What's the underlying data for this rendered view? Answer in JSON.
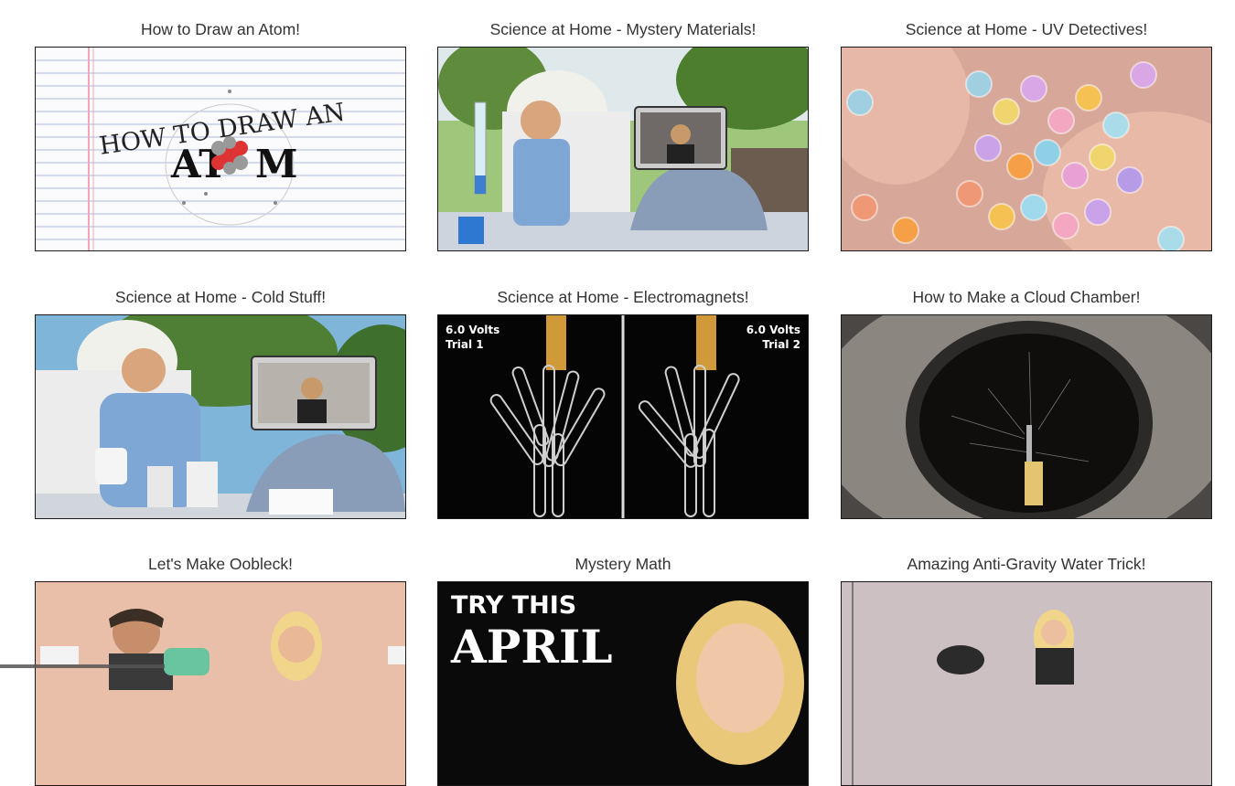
{
  "videos": [
    {
      "title": "How to Draw an Atom!",
      "thumb_text": [
        "HOW TO DRAW AN",
        "AT",
        "M"
      ]
    },
    {
      "title": "Science at Home - Mystery Materials!"
    },
    {
      "title": "Science at Home - UV Detectives!"
    },
    {
      "title": "Science at Home - Cold Stuff!"
    },
    {
      "title": "Science at Home - Electromagnets!",
      "thumb_text": [
        "6.0 Volts",
        "Trial 1",
        "6.0 Volts",
        "Trial 2"
      ]
    },
    {
      "title": "How to Make a Cloud Chamber!"
    },
    {
      "title": "Let's Make Oobleck!"
    },
    {
      "title": "Mystery Math",
      "thumb_text": [
        "TRY THIS",
        "APRIL"
      ]
    },
    {
      "title": "Amazing Anti-Gravity Water Trick!"
    }
  ]
}
